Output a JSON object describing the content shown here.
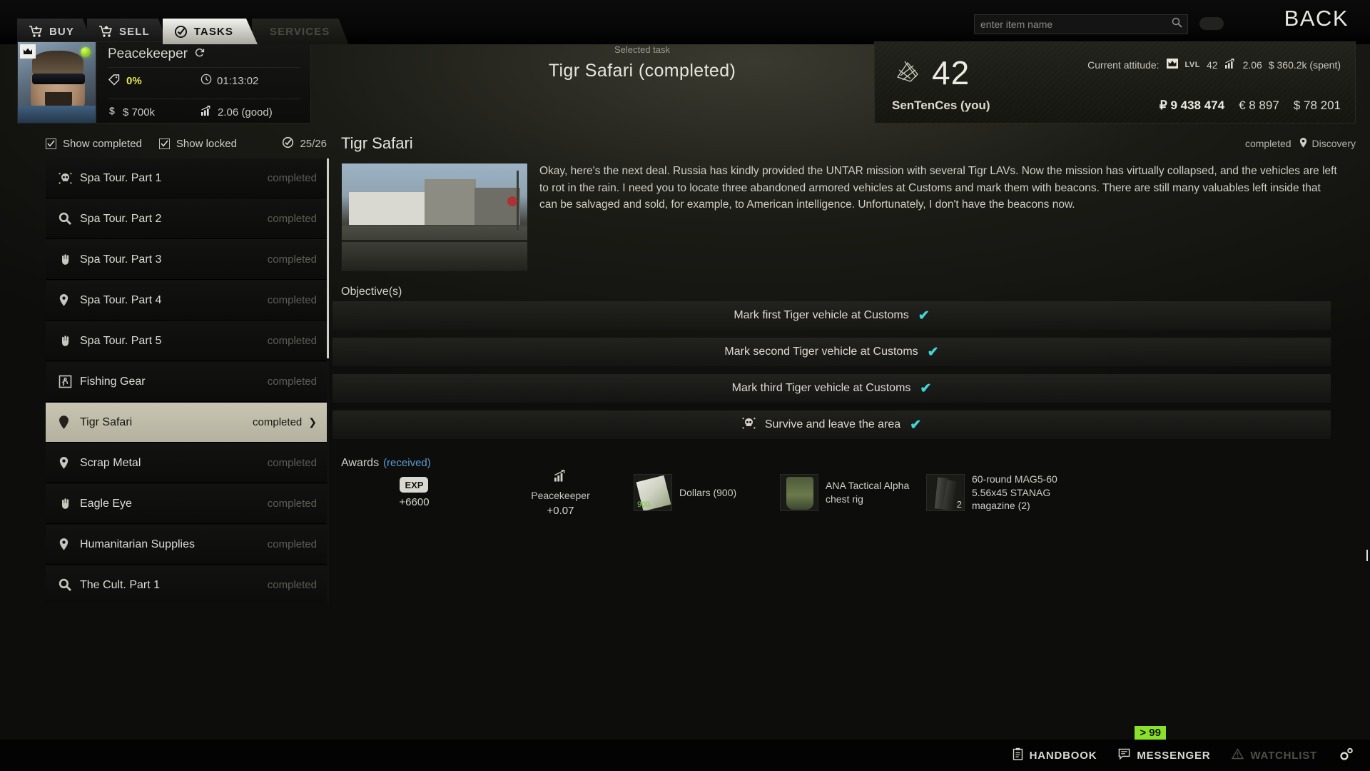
{
  "topbar": {
    "tabs": [
      {
        "label": "BUY",
        "icon": "cart-down-icon",
        "state": "normal"
      },
      {
        "label": "SELL",
        "icon": "cart-up-icon",
        "state": "normal"
      },
      {
        "label": "TASKS",
        "icon": "check-circle-icon",
        "state": "active"
      },
      {
        "label": "SERVICES",
        "icon": "none",
        "state": "disabled"
      }
    ],
    "search_placeholder": "enter item name",
    "search_value": "",
    "back_label": "BACK"
  },
  "trader": {
    "name": "Peacekeeper",
    "discount": "0%",
    "timer": "01:13:02",
    "money": "$ 700k",
    "reputation": "2.06 (good)"
  },
  "selected_task": {
    "caption": "Selected task",
    "title": "Tigr Safari (completed)"
  },
  "player": {
    "level": "42",
    "name": "SenTenCes (you)",
    "attitude_label": "Current attitude:",
    "attitude_lvl_tag": "LVL",
    "attitude_lvl": "42",
    "attitude_rep": "2.06",
    "attitude_spent": "$ 360.2k (spent)",
    "currency_rub": "₽ 9 438 474",
    "currency_eur": "€ 8 897",
    "currency_usd": "$ 78 201"
  },
  "filters": {
    "show_completed": "Show completed",
    "show_locked": "Show locked",
    "counter": "25/26"
  },
  "tasks": [
    {
      "label": "Spa Tour. Part 1",
      "status": "completed",
      "icon": "skull-icon",
      "selected": false
    },
    {
      "label": "Spa Tour. Part 2",
      "status": "completed",
      "icon": "magnifier-icon",
      "selected": false
    },
    {
      "label": "Spa Tour. Part 3",
      "status": "completed",
      "icon": "hand-icon",
      "selected": false
    },
    {
      "label": "Spa Tour. Part 4",
      "status": "completed",
      "icon": "pin-icon",
      "selected": false
    },
    {
      "label": "Spa Tour. Part 5",
      "status": "completed",
      "icon": "hand-icon",
      "selected": false
    },
    {
      "label": "Fishing Gear",
      "status": "completed",
      "icon": "runner-icon",
      "selected": false
    },
    {
      "label": "Tigr Safari",
      "status": "completed",
      "icon": "pin-outline-icon",
      "selected": true
    },
    {
      "label": "Scrap Metal",
      "status": "completed",
      "icon": "pin-icon",
      "selected": false
    },
    {
      "label": "Eagle Eye",
      "status": "completed",
      "icon": "hand-icon",
      "selected": false
    },
    {
      "label": "Humanitarian Supplies",
      "status": "completed",
      "icon": "pin-icon",
      "selected": false
    },
    {
      "label": "The Cult. Part 1",
      "status": "completed",
      "icon": "magnifier-icon",
      "selected": false
    }
  ],
  "detail": {
    "title": "Tigr Safari",
    "status": "completed",
    "location": "Discovery",
    "description": "Okay, here's the next deal.  Russia has kindly provided the UNTAR mission with several Tigr LAVs. Now the mission has virtually collapsed, and the vehicles are left to rot in the rain. I need you to locate three abandoned armored vehicles at Customs and mark them with beacons.  There are still many valuables left inside that can be salvaged and sold, for example, to American intelligence. Unfortunately, I don't have the beacons now.",
    "objectives_label": "Objective(s)",
    "objectives": [
      {
        "text": "Mark first Tiger vehicle at Customs",
        "done": true,
        "icon": "none"
      },
      {
        "text": "Mark second Tiger vehicle at Customs",
        "done": true,
        "icon": "none"
      },
      {
        "text": "Mark third Tiger vehicle at Customs",
        "done": true,
        "icon": "none"
      },
      {
        "text": "Survive and leave the area",
        "done": true,
        "icon": "skull-icon"
      }
    ],
    "awards_label": "Awards",
    "awards_state": "(received)",
    "awards": [
      {
        "kind": "exp",
        "badge": "EXP",
        "value": "+6600"
      },
      {
        "kind": "rep",
        "icon": "rep-chart-icon",
        "name": "Peacekeeper",
        "value": "+0.07"
      },
      {
        "kind": "item",
        "icon": "cash-stack-icon",
        "name": "Dollars (900)",
        "count": "900"
      },
      {
        "kind": "item",
        "icon": "chest-rig-icon",
        "name": "ANA Tactical Alpha chest rig",
        "count": ""
      },
      {
        "kind": "item",
        "icon": "magazine-icon",
        "name": "60-round MAG5-60 5.56x45 STANAG magazine (2)",
        "count": "2"
      }
    ]
  },
  "bottombar": {
    "message_badge": "> 99",
    "items": [
      {
        "label": "HANDBOOK",
        "icon": "clipboard-icon",
        "dim": false
      },
      {
        "label": "MESSENGER",
        "icon": "speech-bubble-icon",
        "dim": false
      },
      {
        "label": "WATCHLIST",
        "icon": "warning-triangle-icon",
        "dim": true
      },
      {
        "label": "",
        "icon": "gears-icon",
        "dim": false
      }
    ]
  },
  "colors": {
    "accent_teal": "#3fd6d6",
    "accent_yellow": "#e8e84a",
    "accent_green": "#8ae02b",
    "selection": "#c8c5b2"
  }
}
